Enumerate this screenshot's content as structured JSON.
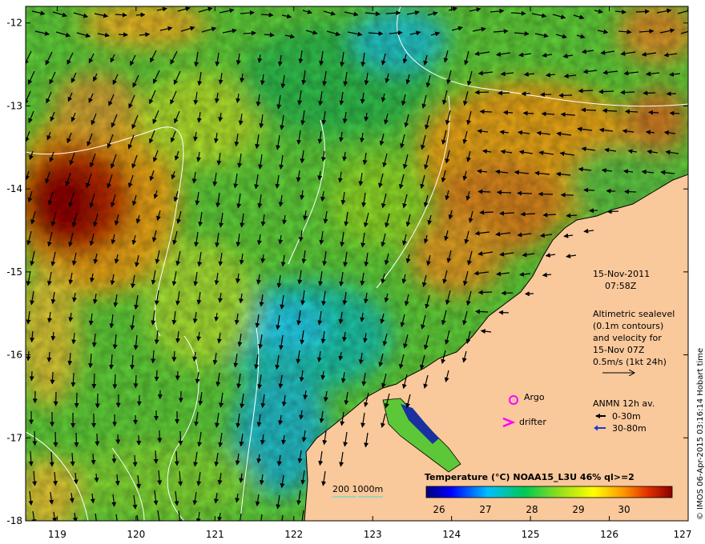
{
  "map": {
    "lon_range": [
      118.6,
      127.0
    ],
    "lat_range": [
      -18.0,
      -11.8
    ],
    "lon_ticks": [
      "119",
      "120",
      "121",
      "122",
      "123",
      "124",
      "125",
      "126",
      "127"
    ],
    "lat_ticks": [
      "-12",
      "-13",
      "-14",
      "-15",
      "-16",
      "-17",
      "-18"
    ]
  },
  "annotations": {
    "date": "15-Nov-2011",
    "time": "07:58Z",
    "alti_lines": [
      "Altimetric sealevel",
      "(0.1m contours)",
      "and velocity for",
      "15-Nov 07Z",
      "0.5m/s (1kt 24h)"
    ],
    "argo_label": "Argo",
    "drifter_label": "drifter",
    "anmn_title": "ANMN 12h av.",
    "anmn_shallow": "0-30m",
    "anmn_deep": "30-80m",
    "depth_label": "200  1000m",
    "colorbar_title": "Temperature (°C) NOAA15_L3U 46% ql>=2",
    "colorbar_ticks": [
      "26",
      "27",
      "28",
      "29",
      "30"
    ],
    "stamp": "© IMOS 06-Apr-2015 03:16:14 Hobart time"
  },
  "colors": {
    "land": "#f9c89b",
    "argo": "#ff00ff",
    "anmn_deep": "#1a3cc8",
    "depth_contour": "#40e0d0"
  }
}
